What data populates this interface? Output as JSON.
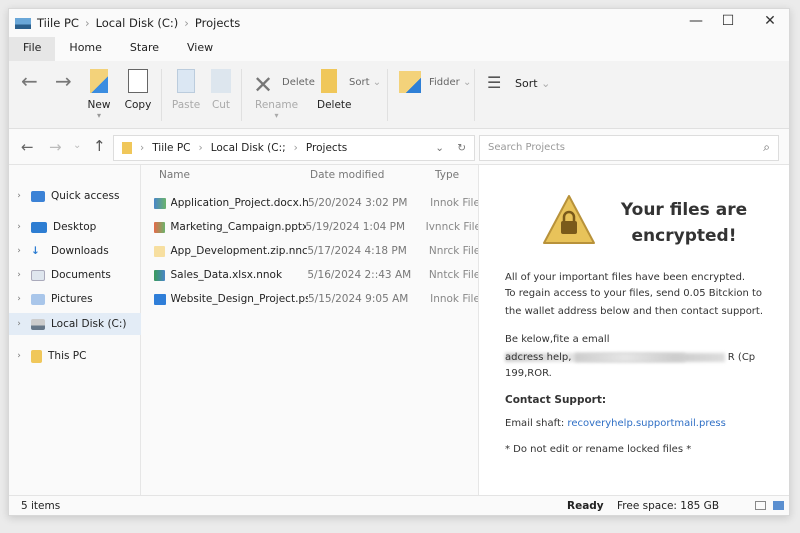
{
  "window": {
    "breadcrumb": [
      "Title PC",
      "Local Disk (C:)",
      "Projects"
    ]
  },
  "title_bar": {
    "crumbs": [
      "Tiile PC",
      "Local Disk (C:)",
      "Projects"
    ]
  },
  "tabs": [
    "File",
    "Home",
    "Stare",
    "View"
  ],
  "ribbon": {
    "new": "New",
    "copy": "Copy",
    "paste": "Paste",
    "cut": "Cut",
    "delete_small": "Delete",
    "rename": "Rename",
    "sort_small": "Sort",
    "delete": "Delete",
    "folder": "Fidder",
    "sort": "Sort"
  },
  "address": {
    "crumbs": [
      "Tiile PC",
      "Local Disk (C:;",
      "Projects"
    ],
    "search_placeholder": "Search Projects"
  },
  "sidebar": [
    {
      "label": "Quick access"
    },
    {
      "label": "Desktop"
    },
    {
      "label": "Downloads"
    },
    {
      "label": "Documents"
    },
    {
      "label": "Pictures"
    },
    {
      "label": "Local Disk (C:)"
    },
    {
      "label": "This PC"
    }
  ],
  "columns": {
    "name": "Name",
    "date": "Date modified",
    "type": "Type"
  },
  "files": [
    {
      "name": "Application_Project.docx.hnols",
      "date": "5/20/2024 3:02 PM",
      "type": "Innok File"
    },
    {
      "name": "Marketing_Campaign.pptx",
      "date": "5/19/2024 1:04 PM",
      "type": "Ivnnck File"
    },
    {
      "name": "App_Development.zip.nncs",
      "date": "5/17/2024 4:18 PM",
      "type": "Nnrck File"
    },
    {
      "name": "Sales_Data.xlsx.nnok",
      "date": "5/16/2024 2::43 AM",
      "type": "Nntck File"
    },
    {
      "name": "Website_Design_Project.psd:",
      "date": "5/15/2024 9:05 AM",
      "type": "Innok File"
    }
  ],
  "ransom": {
    "title": "Your files are encrypted!",
    "p1": "All of your important files have been encrypted.",
    "p2a": "To regain access to your files, send 0.05 Bitckion to",
    "p2b": "the wallet address below and then contact support.",
    "p3a": "Be kelow,fite a emall",
    "p3b": "adcress help,",
    "p3b_end": "R (Cp",
    "p3c": "199,ROR.",
    "contact_heading": "Contact Support:",
    "email_label": "Email  shaft:",
    "email": "recoveryhelp.supportmail.press",
    "note": "* Do not edit or rename locked files *",
    "warning_color": "#e8c35a"
  },
  "status": {
    "items": "5 items",
    "state": "Ready",
    "free": "Free space: 185 GB"
  }
}
